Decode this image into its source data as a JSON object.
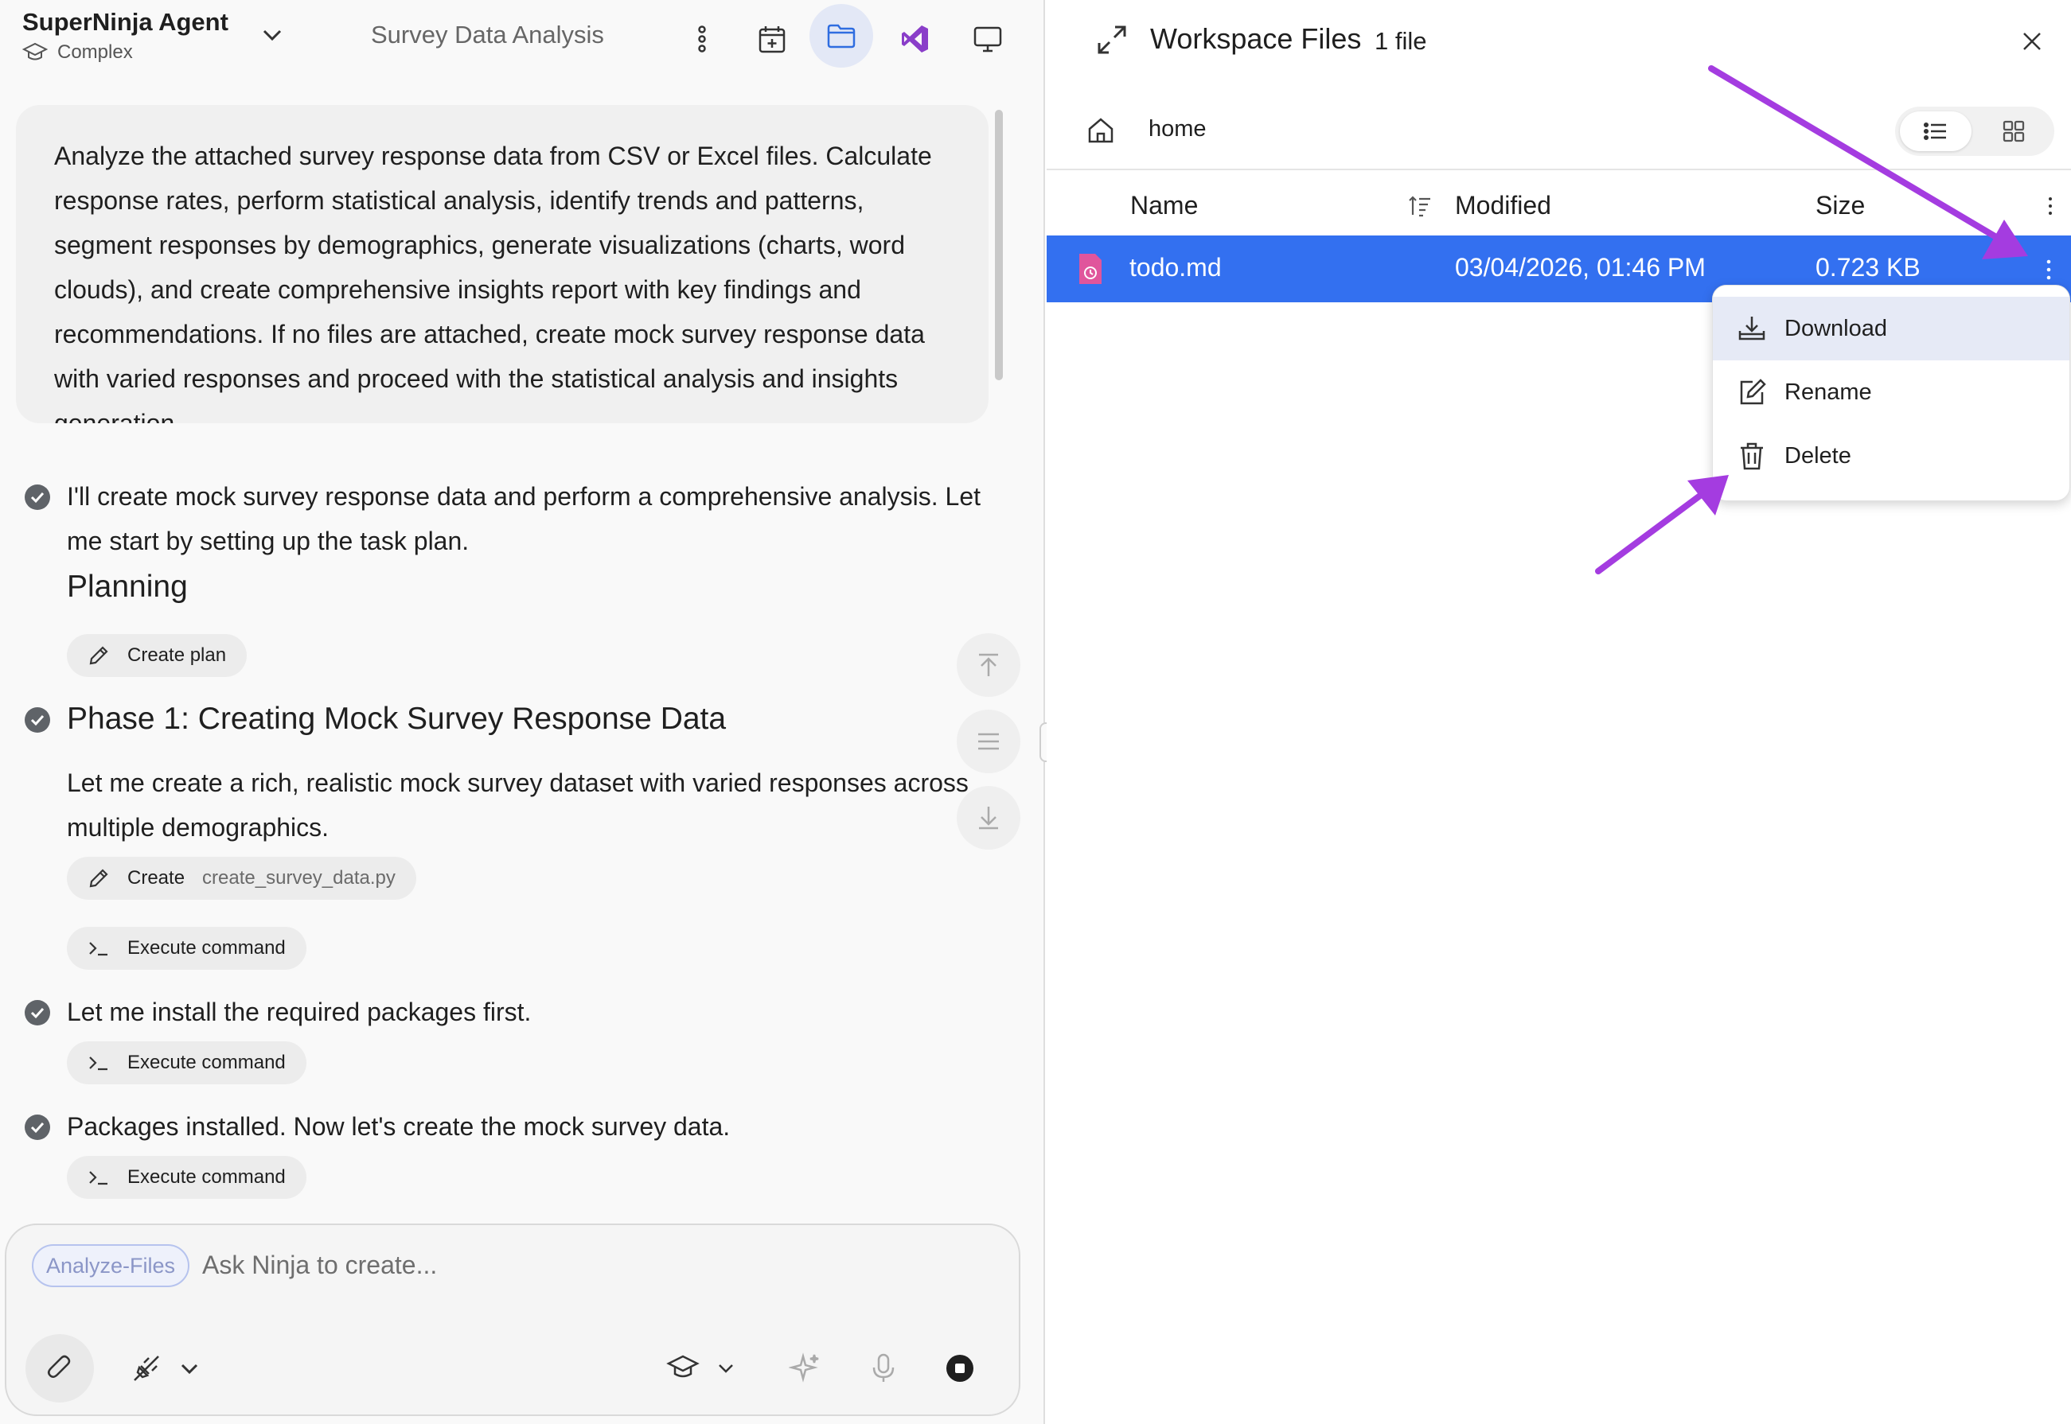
{
  "colors": {
    "accent": "#3370f0",
    "annotation_arrow": "#a43ce0",
    "file_icon": "#e0559c"
  },
  "header": {
    "agent_name": "SuperNinja Agent",
    "agent_mode": "Complex",
    "chat_title": "Survey Data Analysis",
    "icons": [
      "more-vertical-icon",
      "calendar-add-icon",
      "folder-icon",
      "vscode-icon",
      "monitor-icon"
    ]
  },
  "prompt": {
    "text": "Analyze the attached survey response data from CSV or Excel files. Calculate response rates, perform statistical analysis, identify trends and patterns, segment responses by demographics, generate visualizations (charts, word clouds), and create comprehensive insights report with key findings and recommendations. If no files are attached, create mock survey response data with varied responses and proceed with the statistical analysis and insights generation."
  },
  "conversation": {
    "msg1": "I'll create mock survey response data and perform a comprehensive analysis. Let me start by setting up the task plan.",
    "planning_heading": "Planning",
    "create_plan_label": "Create plan",
    "phase1_heading": "Phase 1: Creating Mock Survey Response Data",
    "phase1_text": "Let me create a rich, realistic mock survey dataset with varied responses across multiple demographics.",
    "create_label": "Create",
    "create_file": "create_survey_data.py",
    "execute_label_1": "Execute command",
    "msg2": "Let me install the required packages first.",
    "execute_label_2": "Execute command",
    "msg3": "Packages installed. Now let's create the mock survey data.",
    "execute_label_3": "Execute command"
  },
  "composer": {
    "tag": "Analyze-Files",
    "placeholder": "Ask Ninja to create..."
  },
  "workspace": {
    "title": "Workspace Files",
    "count": "1 file",
    "breadcrumb": "home",
    "columns": {
      "name": "Name",
      "modified": "Modified",
      "size": "Size"
    },
    "files": [
      {
        "name": "todo.md",
        "modified": "03/04/2026, 01:46 PM",
        "size": "0.723 KB"
      }
    ],
    "context_menu": {
      "download": "Download",
      "rename": "Rename",
      "delete": "Delete"
    }
  }
}
